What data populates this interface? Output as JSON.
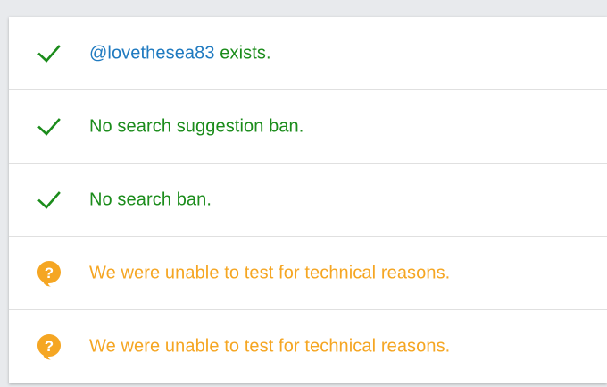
{
  "results": [
    {
      "status": "ok",
      "icon": "checkmark-icon",
      "handle": "@lovethesea83",
      "text": " exists."
    },
    {
      "status": "ok",
      "icon": "checkmark-icon",
      "text": "No search suggestion ban."
    },
    {
      "status": "ok",
      "icon": "checkmark-icon",
      "text": "No search ban."
    },
    {
      "status": "unknown",
      "icon": "question-bubble-icon",
      "text": "We were unable to test for technical reasons."
    },
    {
      "status": "unknown",
      "icon": "question-bubble-icon",
      "text": "We were unable to test for technical reasons."
    }
  ],
  "colors": {
    "ok": "#1b8c1b",
    "warn": "#f5a623",
    "handle": "#1f7ac0"
  }
}
